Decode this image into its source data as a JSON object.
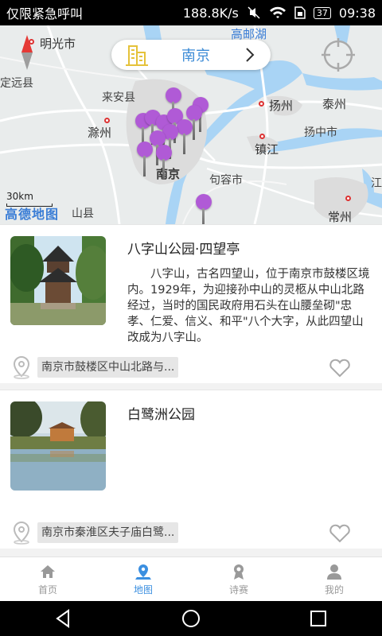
{
  "status_bar": {
    "left_text": "仅限紧急呼叫",
    "speed": "188.8K/s",
    "battery": "37",
    "time": "09:38"
  },
  "map": {
    "search": {
      "city": "南京"
    },
    "scale_label": "30km",
    "logo": "高德地图",
    "labels": [
      {
        "name": "明光市"
      },
      {
        "name": "高邮湖"
      },
      {
        "name": "定远县"
      },
      {
        "name": "来安县"
      },
      {
        "name": "扬州"
      },
      {
        "name": "泰州"
      },
      {
        "name": "滁州"
      },
      {
        "name": "扬中市"
      },
      {
        "name": "镇江"
      },
      {
        "name": "句容市"
      },
      {
        "name": "南京"
      },
      {
        "name": "山县"
      },
      {
        "name": "常州"
      },
      {
        "name": "江"
      }
    ]
  },
  "places": [
    {
      "title": "八字山公园·四望亭",
      "description": "八字山，古名四望山，位于南京市鼓楼区境内。1929年，为迎接孙中山的灵柩从中山北路经过，当时的国民政府用石头在山腰垒砌\"忠孝、仁爱、信义、和平\"八个大字，从此四望山改成为八字山。",
      "address": "南京市鼓楼区中山北路与..."
    },
    {
      "title": "白鹭洲公园",
      "description": "",
      "address": "南京市秦淮区夫子庙白鹭..."
    }
  ],
  "tabs": [
    {
      "label": "首页",
      "icon": "home-icon"
    },
    {
      "label": "地图",
      "icon": "map-pin-icon"
    },
    {
      "label": "诗赛",
      "icon": "award-icon"
    },
    {
      "label": "我的",
      "icon": "user-icon"
    }
  ],
  "colors": {
    "accent": "#3b8fe0",
    "pin": "#b05ad6"
  }
}
